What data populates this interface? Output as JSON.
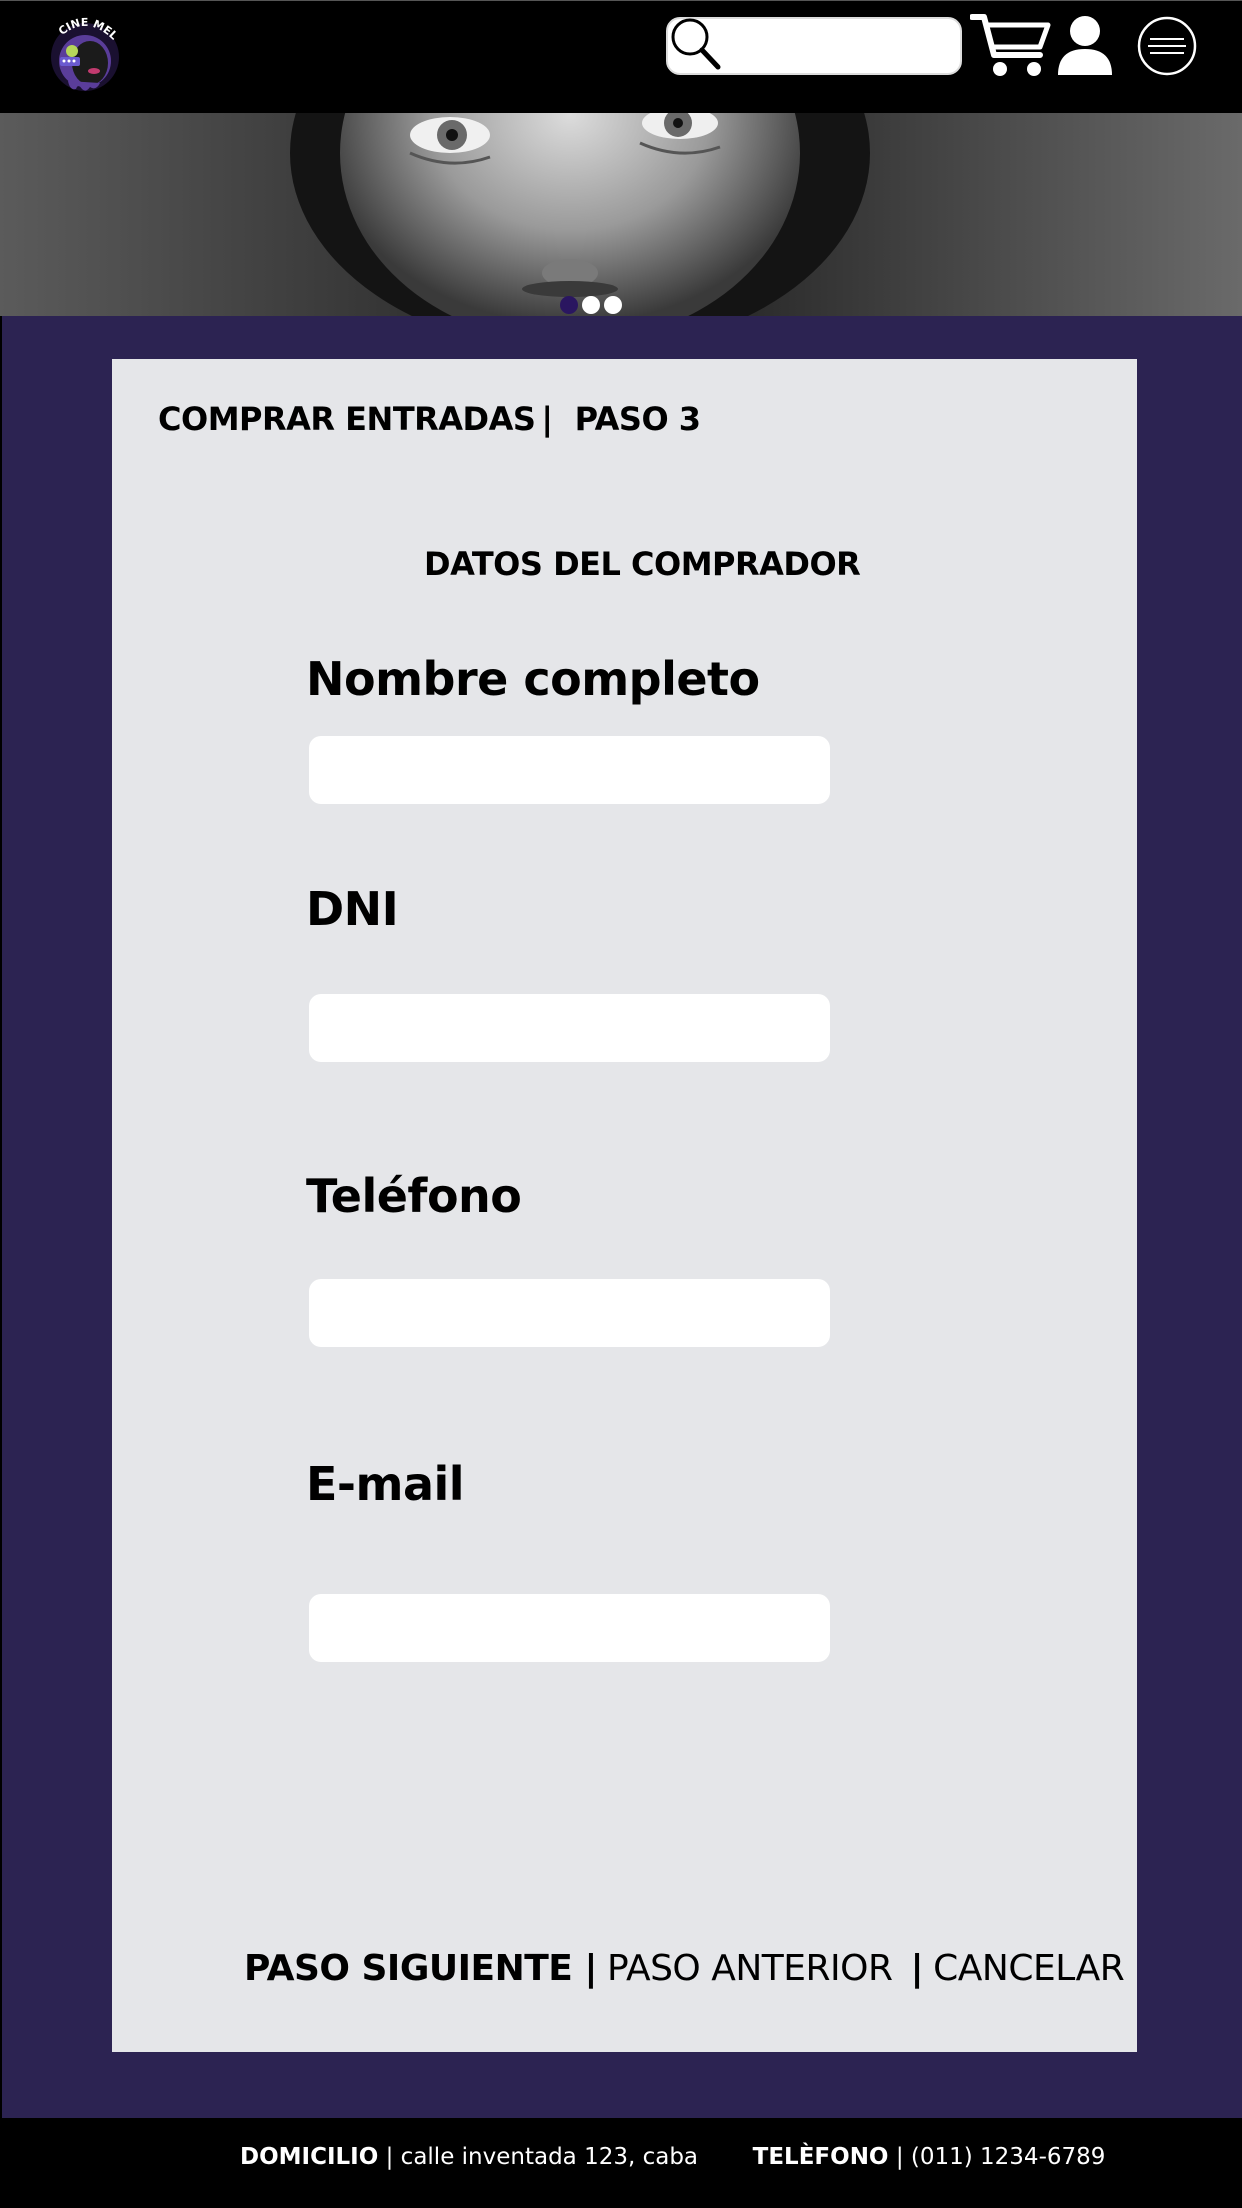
{
  "header": {
    "logo_text": "CINE MELIES",
    "search": {
      "placeholder": ""
    },
    "icons": [
      "search-icon",
      "cart-icon",
      "user-icon",
      "menu-icon"
    ]
  },
  "hero": {
    "carousel": {
      "total": 3,
      "active_index": 0
    },
    "colors": {
      "dot_active": "#2a1660",
      "dot_inactive": "#ffffff"
    }
  },
  "purchase": {
    "title": "COMPRAR ENTRADAS",
    "separator": "|",
    "step": "PASO 3",
    "section_title": "DATOS DEL COMPRADOR",
    "fields": [
      {
        "label": "Nombre completo",
        "value": "",
        "placeholder": ""
      },
      {
        "label": "DNI",
        "value": "",
        "placeholder": ""
      },
      {
        "label": "Teléfono",
        "value": "",
        "placeholder": ""
      },
      {
        "label": "E-mail",
        "value": "",
        "placeholder": ""
      }
    ],
    "actions": {
      "next": "PASO SIGUIENTE",
      "separator": "|",
      "previous": "PASO ANTERIOR",
      "cancel": "CANCELAR"
    }
  },
  "footer": {
    "address_label": "DOMICILIO",
    "address_value": "| calle inventada 123, caba",
    "phone_label": "TELÈFONO",
    "phone_value": "| (011) 1234-6789"
  },
  "colors": {
    "header_bg": "#000000",
    "main_bg": "#2c2352",
    "card_bg": "#e5e6e9",
    "input_bg": "#ffffff",
    "footer_bg": "#000000"
  }
}
